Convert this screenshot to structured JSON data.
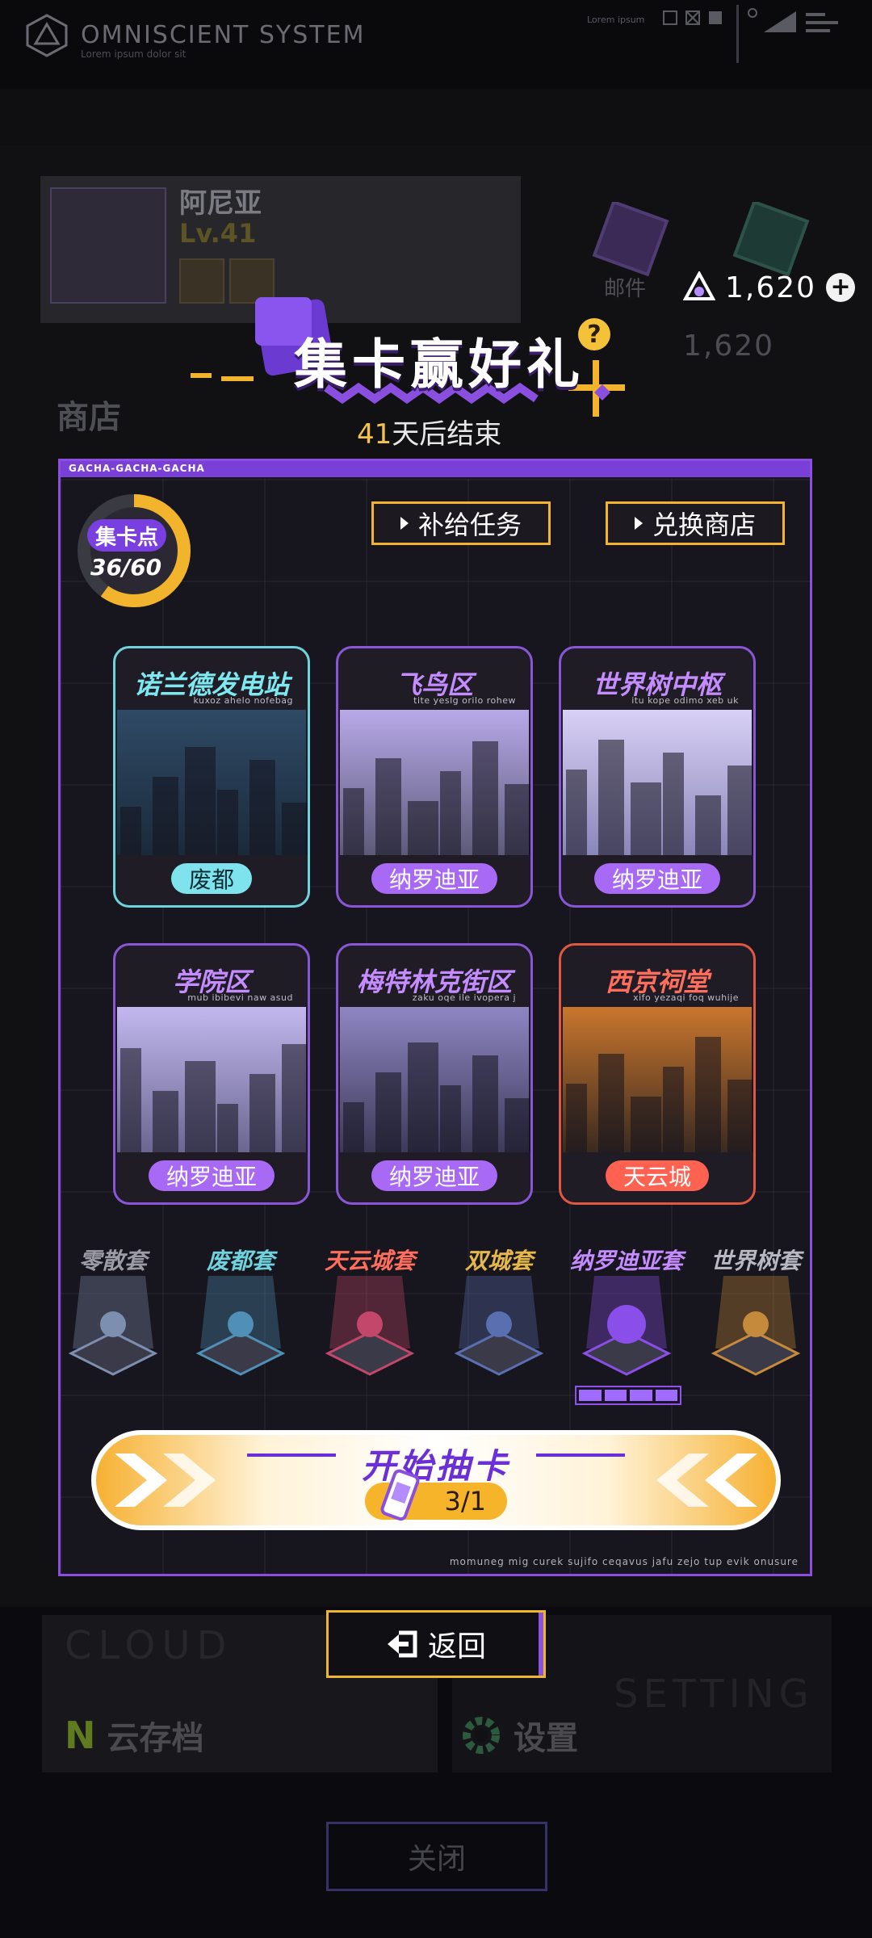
{
  "system": {
    "title": "OMNISCIENT  SYSTEM",
    "subtitle": "Lorem ipsum dolor sit",
    "lorem_label": "Lorem ipsum"
  },
  "profile": {
    "name": "阿尼亚",
    "level": "Lv.41"
  },
  "mail_label": "邮件",
  "currency": {
    "value": "1,620",
    "plus": "+"
  },
  "shop_label": "商店",
  "banner": {
    "title": "集卡赢好礼",
    "days": "41",
    "days_suffix": "天后结束",
    "help": "?"
  },
  "panel": {
    "header": "GACHA-GACHA-GACHA",
    "footer": "momuneg mig curek sujifo ceqavus jafu zejo tup evik onusure"
  },
  "points": {
    "label": "集卡点",
    "value": "36/60",
    "current": 36,
    "max": 60
  },
  "buttons": {
    "supply_task": "补给任务",
    "exchange_shop": "兑换商店"
  },
  "zones": [
    {
      "title": "诺兰德发电站",
      "sub": "kuxoz ahelo nofebag",
      "tag": "废都",
      "title_color": "#7ee8f0",
      "tag_bg": "#7fe3ee",
      "tag_color": "#0b2e33",
      "border": "#6fd3dc"
    },
    {
      "title": "飞鸟区",
      "sub": "tite yeslg orilo rohew",
      "tag": "纳罗迪亚",
      "title_color": "#c48cff",
      "tag_bg": "#a869f4",
      "tag_color": "#ffffff",
      "border": "#8a56d8"
    },
    {
      "title": "世界树中枢",
      "sub": "itu kope odimo xeb uk",
      "tag": "纳罗迪亚",
      "title_color": "#c48cff",
      "tag_bg": "#a869f4",
      "tag_color": "#ffffff",
      "border": "#8a56d8"
    },
    {
      "title": "学院区",
      "sub": "mub ibibevi naw asud",
      "tag": "纳罗迪亚",
      "title_color": "#c48cff",
      "tag_bg": "#a869f4",
      "tag_color": "#ffffff",
      "border": "#8a56d8"
    },
    {
      "title": "梅特林克街区",
      "sub": "zaku oqe ile ivopera j",
      "tag": "纳罗迪亚",
      "title_color": "#c48cff",
      "tag_bg": "#a869f4",
      "tag_color": "#ffffff",
      "border": "#8a56d8"
    },
    {
      "title": "西京祠堂",
      "sub": "xifo yezaqi foq wuhije",
      "tag": "天云城",
      "title_color": "#ff6e5c",
      "tag_bg": "#ff6251",
      "tag_color": "#ffffff",
      "border": "#e0583f"
    }
  ],
  "sets": [
    {
      "name": "零散套",
      "color": "#9c9ca6"
    },
    {
      "name": "废都套",
      "color": "#6fd3de"
    },
    {
      "name": "天云城套",
      "color": "#ff6e5c"
    },
    {
      "name": "双城套",
      "color": "#e6b84a"
    },
    {
      "name": "纳罗迪亚套",
      "color": "#c48cff"
    },
    {
      "name": "世界树套",
      "color": "#b8b8c2"
    }
  ],
  "set_progress": 4,
  "draw": {
    "title": "开始抽卡",
    "count": "3/1"
  },
  "back_label": "返回",
  "bottom": {
    "cloud_ghost": "CLOUD",
    "cloud_label": "云存档",
    "setting_ghost": "SETTING",
    "setting_label": "设置",
    "close_label": "关闭"
  },
  "colors": {
    "accent_purple": "#8b4fe0",
    "accent_gold": "#f2b42d"
  }
}
